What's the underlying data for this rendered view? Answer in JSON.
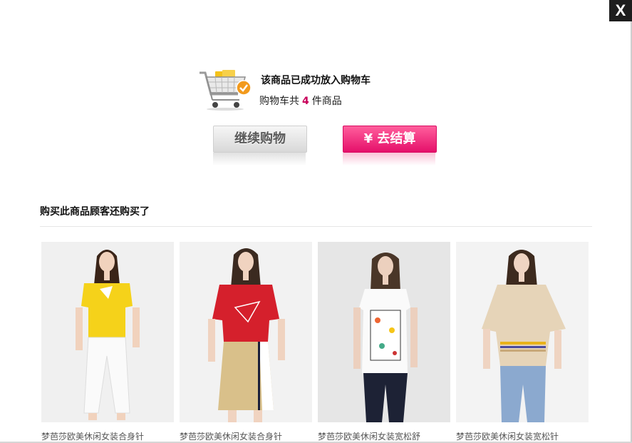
{
  "close": {
    "label": "X"
  },
  "notice": {
    "title": "该商品已成功放入购物车",
    "count_prefix": "购物车共",
    "count": "4",
    "count_suffix": "件商品"
  },
  "buttons": {
    "continue_label": "继续购物",
    "checkout_label": "¥ 去结算"
  },
  "recommend": {
    "title": "购买此商品顾客还购买了",
    "items": [
      {
        "name": "梦芭莎欧美休闲女装合身针"
      },
      {
        "name": "梦芭莎欧美休闲女装合身针"
      },
      {
        "name": "梦芭莎欧美休闲女装宽松舒"
      },
      {
        "name": "梦芭莎欧美休闲女装宽松针"
      }
    ]
  },
  "colors": {
    "accent": "#e5106a",
    "count": "#c8005a"
  }
}
